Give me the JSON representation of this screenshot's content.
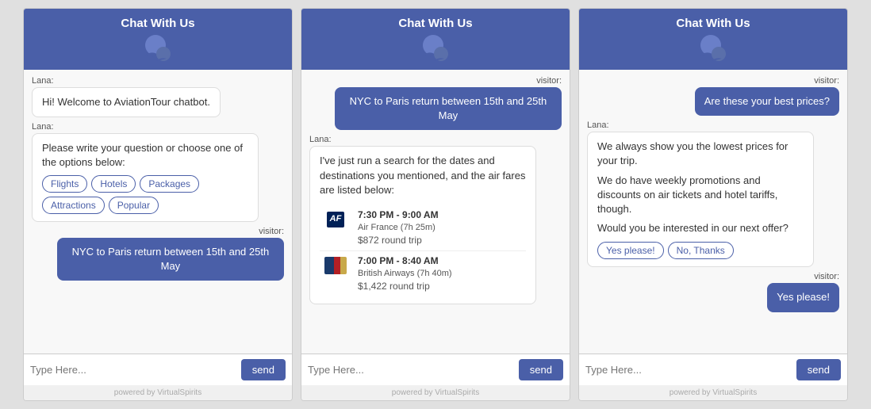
{
  "header": {
    "title": "Chat With Us"
  },
  "widget1": {
    "messages": [
      {
        "sender": "Lana",
        "text": "Hi! Welcome to AviationTour chatbot."
      },
      {
        "sender": "Lana",
        "text": "Please write your question or choose one of the options below:"
      },
      {
        "sender": "visitor",
        "text": "NYC to Paris return between 15th and 25th May"
      }
    ],
    "options": [
      "Flights",
      "Hotels",
      "Packages",
      "Attractions",
      "Popular"
    ]
  },
  "widget2": {
    "visitor_msg": "NYC to Paris return between 15th and 25th May",
    "lana_msg": "I've just run a search for the dates and destinations you mentioned, and the air fares are listed below:",
    "flights": [
      {
        "time": "7:30 PM - 9:00 AM",
        "airline": "Air France (7h 25m)",
        "price": "$872",
        "price_label": "round trip"
      },
      {
        "time": "7:00 PM - 8:40 AM",
        "airline": "British Airways (7h 40m)",
        "price": "$1,422",
        "price_label": "round trip"
      }
    ]
  },
  "widget3": {
    "visitor_msg1": "Are these your best prices?",
    "lana_msg": "We always show you the lowest prices for your trip.\nWe do have weekly promotions and discounts on air tickets and hotel tariffs, though.\n\nWould you be interested in our next offer?",
    "options": [
      "Yes please!",
      "No, Thanks"
    ],
    "visitor_msg2": "Yes please!"
  },
  "footer": {
    "placeholder": "Type Here...",
    "send_label": "send",
    "powered": "powered by VirtualSpirits"
  }
}
